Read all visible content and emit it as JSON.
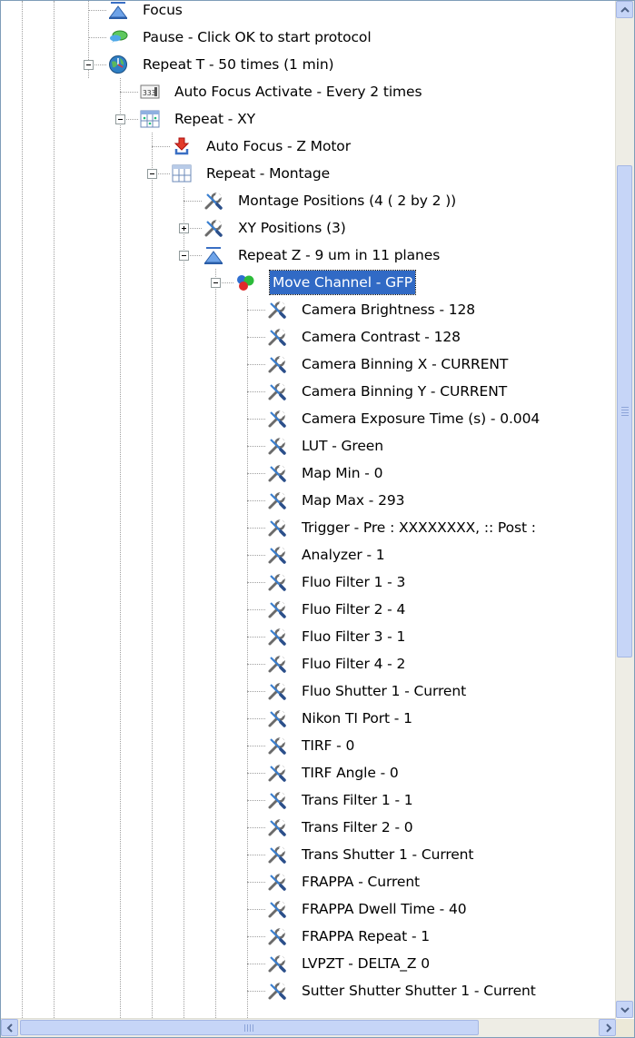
{
  "tree": {
    "nodes": [
      {
        "label": "Focus",
        "icon": "z-focus-icon"
      },
      {
        "label": "Pause - Click OK to start protocol",
        "icon": "speech-bubble-icon"
      },
      {
        "label": "Repeat T - 50 times (1 min)",
        "icon": "clock-globe-icon"
      },
      {
        "label": "Auto Focus Activate - Every 2 times",
        "icon": "counter-icon"
      },
      {
        "label": "Repeat - XY",
        "icon": "xy-grid-icon"
      },
      {
        "label": "Auto Focus - Z Motor",
        "icon": "down-arrow-tray-icon"
      },
      {
        "label": "Repeat - Montage",
        "icon": "montage-grid-icon"
      },
      {
        "label": "Montage Positions (4 ( 2 by 2 ))",
        "icon": "tools-icon"
      },
      {
        "label": "XY Positions (3)",
        "icon": "tools-icon"
      },
      {
        "label": "Repeat Z - 9 um in 11 planes",
        "icon": "z-focus-icon"
      },
      {
        "label": "Move Channel - GFP",
        "icon": "rgb-channels-icon"
      },
      {
        "label": "Camera Brightness - 128",
        "icon": "tools-icon"
      },
      {
        "label": "Camera Contrast - 128",
        "icon": "tools-icon"
      },
      {
        "label": "Camera Binning X - CURRENT",
        "icon": "tools-icon"
      },
      {
        "label": "Camera Binning Y - CURRENT",
        "icon": "tools-icon"
      },
      {
        "label": "Camera Exposure Time (s) - 0.004",
        "icon": "tools-icon"
      },
      {
        "label": "LUT - Green",
        "icon": "tools-icon"
      },
      {
        "label": "Map Min - 0",
        "icon": "tools-icon"
      },
      {
        "label": "Map Max - 293",
        "icon": "tools-icon"
      },
      {
        "label": "Trigger - Pre : XXXXXXXX, :: Post :",
        "icon": "tools-icon"
      },
      {
        "label": "Analyzer - 1",
        "icon": "tools-icon"
      },
      {
        "label": "Fluo Filter 1 - 3",
        "icon": "tools-icon"
      },
      {
        "label": "Fluo Filter 2 - 4",
        "icon": "tools-icon"
      },
      {
        "label": "Fluo Filter 3 - 1",
        "icon": "tools-icon"
      },
      {
        "label": "Fluo Filter 4 - 2",
        "icon": "tools-icon"
      },
      {
        "label": "Fluo Shutter 1 - Current",
        "icon": "tools-icon"
      },
      {
        "label": "Nikon TI Port - 1",
        "icon": "tools-icon"
      },
      {
        "label": "TIRF - 0",
        "icon": "tools-icon"
      },
      {
        "label": "TIRF Angle - 0",
        "icon": "tools-icon"
      },
      {
        "label": "Trans Filter 1 - 1",
        "icon": "tools-icon"
      },
      {
        "label": "Trans Filter 2 - 0",
        "icon": "tools-icon"
      },
      {
        "label": "Trans Shutter 1 - Current",
        "icon": "tools-icon"
      },
      {
        "label": "FRAPPA - Current",
        "icon": "tools-icon"
      },
      {
        "label": "FRAPPA Dwell Time - 40",
        "icon": "tools-icon"
      },
      {
        "label": "FRAPPA Repeat - 1",
        "icon": "tools-icon"
      },
      {
        "label": "LVPZT - DELTA_Z 0",
        "icon": "tools-icon"
      },
      {
        "label": "Sutter Shutter Shutter 1 - Current",
        "icon": "tools-icon"
      }
    ],
    "selected_label": "Move Channel - GFP"
  },
  "scrollbars": {
    "up_icon": "chevron-up-icon",
    "down_icon": "chevron-down-icon",
    "left_icon": "chevron-left-icon",
    "right_icon": "chevron-right-icon"
  },
  "colors": {
    "selection_bg": "#316ac5",
    "scroll_thumb": "#c6d5f7",
    "tree_lines": "#a0a0a0"
  }
}
